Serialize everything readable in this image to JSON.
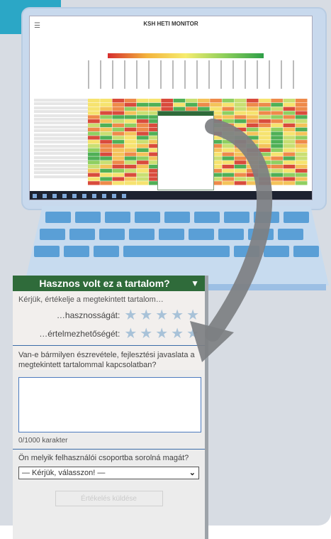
{
  "corner_tag": "a",
  "screen": {
    "title": "KSH HETI MONITOR",
    "menu_icon": "hamburger-menu-icon"
  },
  "panel": {
    "header_title": "Hasznos volt ez a tartalom?",
    "collapse_icon": "triangle-down-icon",
    "intro": "Kérjük, értékelje a megtekintett tartalom…",
    "rating_usefulness_label": "…hasznosságát:",
    "rating_clarity_label": "…értelmezhetőségét:",
    "star_icon": "star-icon",
    "comment_question": "Van-e bármilyen észrevétele, fejlesztési javaslata a megtekintett tartalommal kapcsolatban?",
    "comment_value": "",
    "char_counter": "0/1000 karakter",
    "group_question": "Ön melyik felhasználói csoportba sorolná magát?",
    "group_select_value": "— Kérjük, válasszon! —",
    "submit_label": "Értékelés küldése"
  },
  "colors": {
    "header_green": "#2f6b3a",
    "accent_blue": "#2ba7c6",
    "star_inactive": "#a8c2d8",
    "border_blue": "#4d7bbf"
  }
}
